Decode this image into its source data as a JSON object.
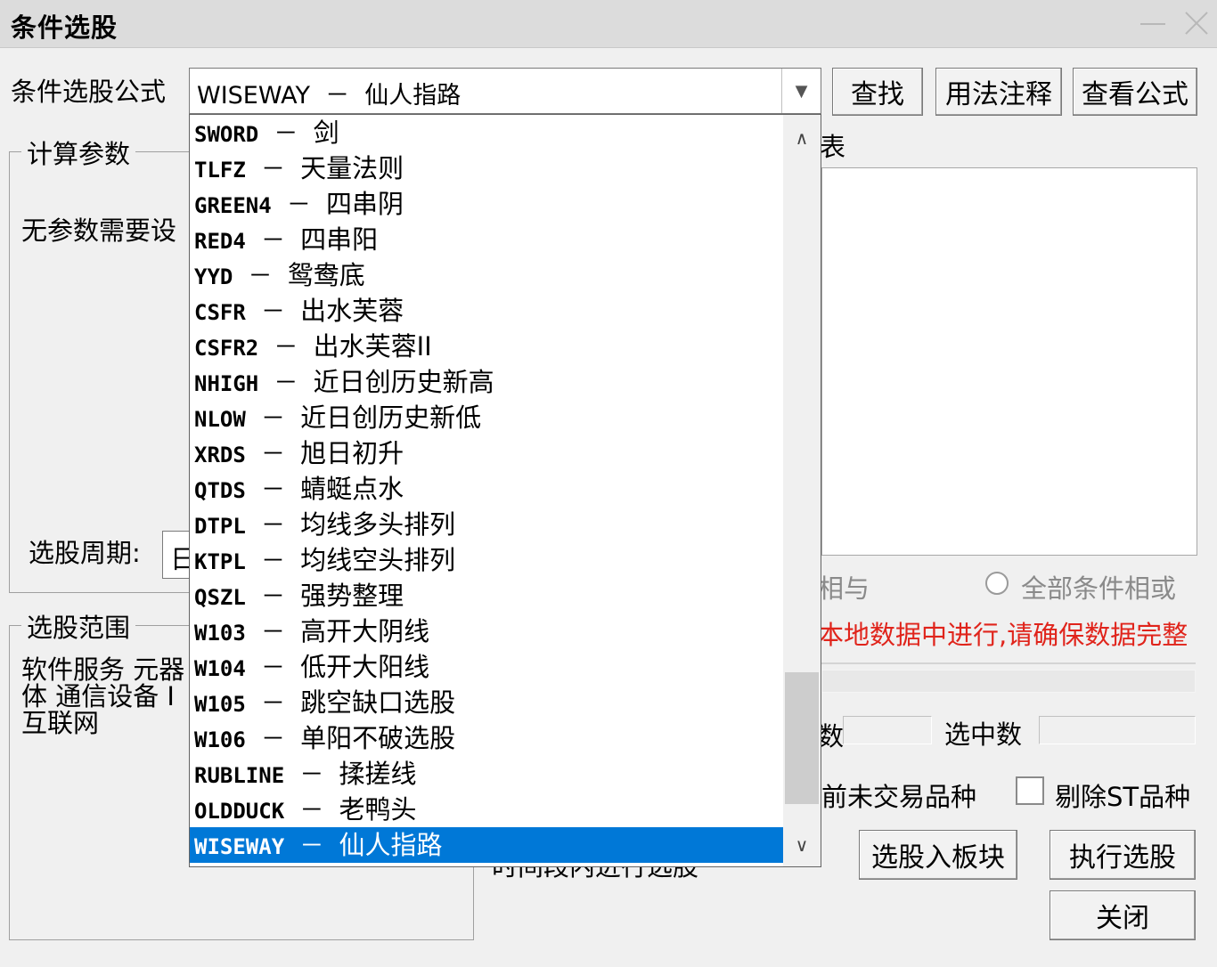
{
  "window": {
    "title": "条件选股"
  },
  "formula": {
    "label": "条件选股公式",
    "selected": "WISEWAY  －  仙人指路"
  },
  "buttons": {
    "find": "查找",
    "usage": "用法注释",
    "view_formula": "查看公式",
    "add_to_block": "选股入板块",
    "execute": "执行选股",
    "close": "关闭"
  },
  "params": {
    "legend": "计算参数",
    "no_params": "无参数需要设",
    "period_label": "选股周期:",
    "period_value": "日"
  },
  "scope": {
    "legend": "选股范围",
    "line1": "软件服务 元器",
    "line2": "体 通信设备 I",
    "line3": "互联网"
  },
  "right_panel": {
    "top_fragment": "表",
    "radio_and_fragment": "相与",
    "radio_or_label": "全部条件相或",
    "warning_text": "本地数据中进行,请确保数据完整",
    "count_fragment": "数",
    "selected_count_label": "选中数",
    "untraded_fragment": "前未交易品种",
    "exclude_st_label": "剔除ST品种",
    "hidden_fragment": "时间段内进行选股"
  },
  "dropdown": {
    "items": [
      {
        "code": "SWORD",
        "sep": "  －  ",
        "name": "剑"
      },
      {
        "code": "TLFZ",
        "sep": "  －  ",
        "name": "天量法则"
      },
      {
        "code": "GREEN4",
        "sep": "  －  ",
        "name": "四串阴"
      },
      {
        "code": "RED4",
        "sep": "  －  ",
        "name": "四串阳"
      },
      {
        "code": "YYD",
        "sep": "  －  ",
        "name": "鸳鸯底"
      },
      {
        "code": "CSFR",
        "sep": "  －  ",
        "name": "出水芙蓉"
      },
      {
        "code": "CSFR2",
        "sep": "  －  ",
        "name": "出水芙蓉II"
      },
      {
        "code": "NHIGH",
        "sep": "  －  ",
        "name": "近日创历史新高"
      },
      {
        "code": "NLOW",
        "sep": "  －  ",
        "name": "近日创历史新低"
      },
      {
        "code": "XRDS",
        "sep": "  －  ",
        "name": "旭日初升"
      },
      {
        "code": "QTDS",
        "sep": "  －  ",
        "name": "蜻蜓点水"
      },
      {
        "code": "DTPL",
        "sep": "  －  ",
        "name": "均线多头排列"
      },
      {
        "code": "KTPL",
        "sep": "  －  ",
        "name": "均线空头排列"
      },
      {
        "code": "QSZL",
        "sep": "  －  ",
        "name": "强势整理"
      },
      {
        "code": "W103",
        "sep": "  －  ",
        "name": "高开大阴线"
      },
      {
        "code": "W104",
        "sep": "  －  ",
        "name": "低开大阳线"
      },
      {
        "code": "W105",
        "sep": "  －  ",
        "name": "跳空缺口选股"
      },
      {
        "code": "W106",
        "sep": "  －  ",
        "name": "单阳不破选股"
      },
      {
        "code": "RUBLINE",
        "sep": "  －  ",
        "name": "揉搓线"
      },
      {
        "code": "OLDDUCK",
        "sep": "  －  ",
        "name": "老鸭头"
      },
      {
        "code": "WISEWAY",
        "sep": "  －  ",
        "name": "仙人指路",
        "selected": true
      }
    ]
  }
}
